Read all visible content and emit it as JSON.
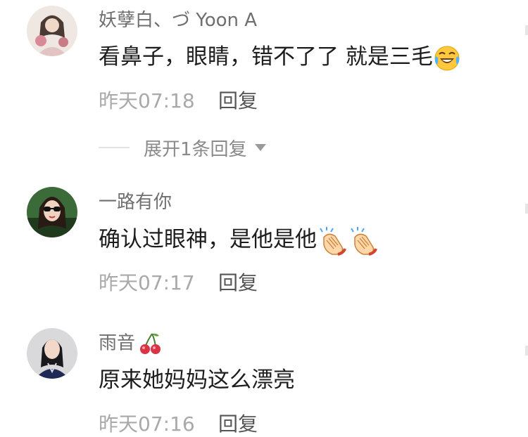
{
  "comments": [
    {
      "username": "妖孽白、づ Yoon A",
      "avatar": "avatar-girl-floral-icon",
      "text": "看鼻子，眼睛，错不了了 就是三毛",
      "emoji": "rolling-laughing-face-icon",
      "time": "昨天07:18",
      "reply_label": "回复",
      "expand_label": "展开1条回复"
    },
    {
      "username": "一路有你",
      "avatar": "avatar-woman-sunglasses-icon",
      "text": "确认过眼神，是他是他",
      "emoji": "clapping-hands-icon",
      "time": "昨天07:17",
      "reply_label": "回复"
    },
    {
      "username": "雨音",
      "avatar": "avatar-woman-dark-icon",
      "username_emoji": "cherries-icon",
      "text": "原来她妈妈这么漂亮",
      "time": "昨天07:16",
      "reply_label": "回复"
    }
  ],
  "colors": {
    "username": "#6f6f6f",
    "text": "#1d1d1d",
    "time": "#a9a9a9",
    "reply": "#555555",
    "divider": "#e3e3e3"
  }
}
